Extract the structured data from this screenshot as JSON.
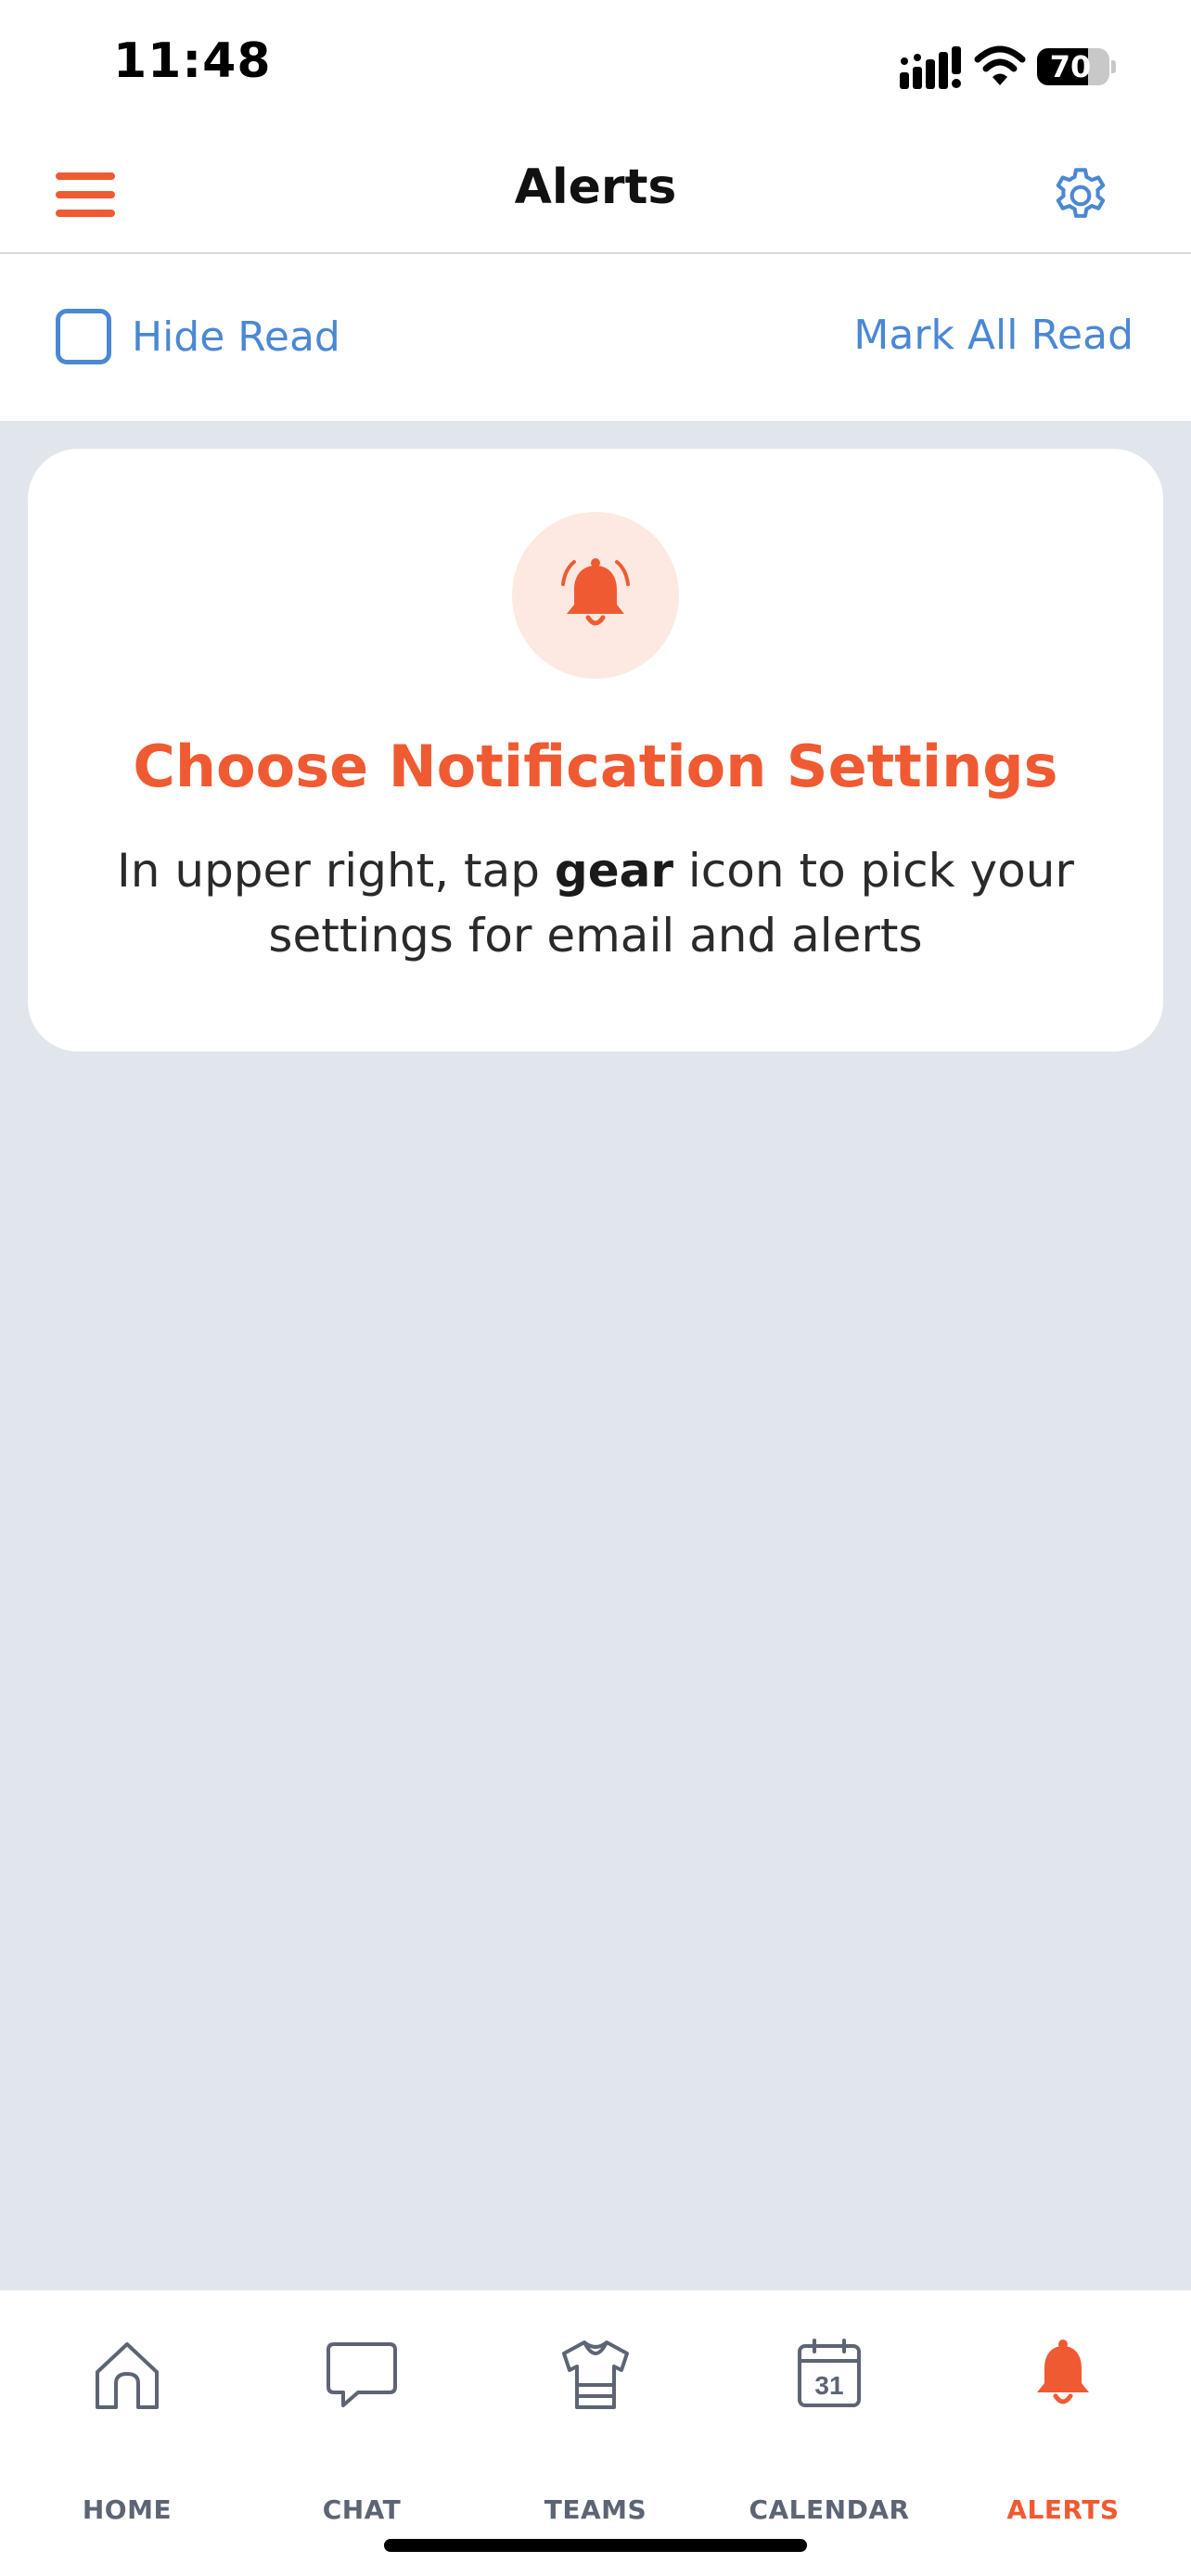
{
  "status_bar": {
    "time": "11:48",
    "battery_percent": 70,
    "battery_label": "70"
  },
  "header": {
    "title": "Alerts",
    "menu_icon": "hamburger-menu-icon",
    "settings_icon": "gear-icon"
  },
  "toolbar": {
    "hide_read_label": "Hide Read",
    "hide_read_checked": false,
    "mark_all_read_label": "Mark All Read"
  },
  "notice": {
    "icon": "bell-icon",
    "title": "Choose Notification Settings",
    "body_prefix": "In upper right, tap ",
    "body_bold": "gear",
    "body_suffix": " icon to pick your settings for email and alerts"
  },
  "nav": {
    "items": [
      {
        "label": "HOME",
        "icon": "home-icon",
        "active": false
      },
      {
        "label": "CHAT",
        "icon": "chat-bubble-icon",
        "active": false
      },
      {
        "label": "TEAMS",
        "icon": "jersey-icon",
        "active": false
      },
      {
        "label": "CALENDAR",
        "icon": "calendar-icon",
        "active": false,
        "icon_text": "31"
      },
      {
        "label": "ALERTS",
        "icon": "bell-icon",
        "active": true
      }
    ]
  },
  "colors": {
    "accent": "#f05a32",
    "link": "#4a88d4",
    "background": "#e1e5ec",
    "nav_inactive": "#5d6474"
  }
}
